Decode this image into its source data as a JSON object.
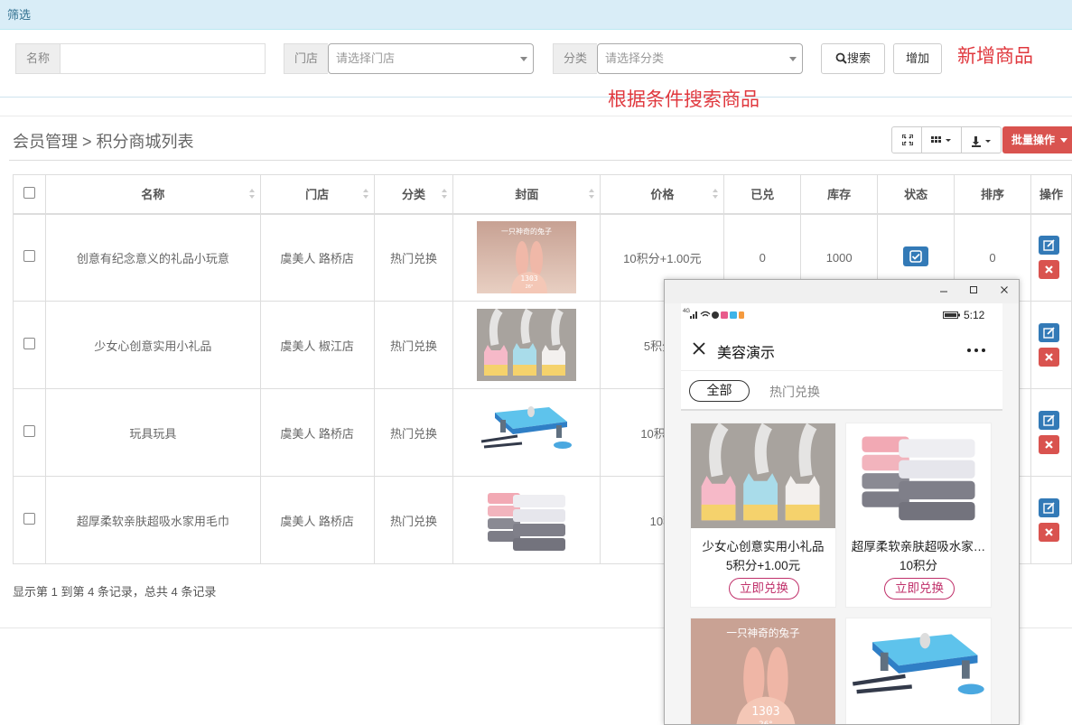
{
  "filter_bar": {
    "title": "筛选"
  },
  "filter_form": {
    "name_label": "名称",
    "name_value": "",
    "store_label": "门店",
    "store_placeholder": "请选择门店",
    "category_label": "分类",
    "category_placeholder": "请选择分类",
    "search_label": "搜索",
    "add_label": "增加"
  },
  "annotations": {
    "add_note": "新增商品",
    "search_note": "根据条件搜索商品"
  },
  "breadcrumb": "会员管理 > 积分商城列表",
  "toolbar": {
    "batch_label": "批量操作"
  },
  "table": {
    "columns": [
      "名称",
      "门店",
      "分类",
      "封面",
      "价格",
      "已兑",
      "库存",
      "状态",
      "排序",
      "操作"
    ],
    "rows": [
      {
        "name": "创意有纪念意义的礼品小玩意",
        "store": "虞美人 路桥店",
        "category": "热门兑换",
        "cover": "rabbit-clock",
        "price": "10积分+1.00元",
        "redeemed": "0",
        "stock": "1000",
        "sort": "0"
      },
      {
        "name": "少女心创意实用小礼品",
        "store": "虞美人 椒江店",
        "category": "热门兑换",
        "cover": "cat-humidifier",
        "price": "5积分+",
        "redeemed": "",
        "stock": "",
        "sort": ""
      },
      {
        "name": "玩具玩具",
        "store": "虞美人 路桥店",
        "category": "热门兑换",
        "cover": "penguin-ice-game",
        "price": "10积分+",
        "redeemed": "",
        "stock": "",
        "sort": ""
      },
      {
        "name": "超厚柔软亲肤超吸水家用毛巾",
        "store": "虞美人 路桥店",
        "category": "热门兑换",
        "cover": "towels",
        "price": "10积",
        "redeemed": "",
        "stock": "",
        "sort": ""
      }
    ]
  },
  "pager": "显示第 1 到第 4 条记录，总共 4 条记录",
  "phone": {
    "signal_text": "4G",
    "time": "5:12",
    "title": "美容演示",
    "tabs": [
      "全部",
      "热门兑换"
    ],
    "products": [
      {
        "name": "少女心创意实用小礼品",
        "price": "5积分+1.00元",
        "button": "立即兑换",
        "image": "cat-humidifier"
      },
      {
        "name": "超厚柔软亲肤超吸水家…",
        "price": "10积分",
        "button": "立即兑换",
        "image": "towels"
      },
      {
        "name": "",
        "price": "",
        "button": "",
        "image": "rabbit-clock",
        "image_text": "一只神奇的兔子"
      },
      {
        "name": "",
        "price": "",
        "button": "",
        "image": "penguin-ice-game"
      }
    ],
    "rabbit_image_text": "一只神奇的兔子",
    "rabbit_clock_time": "1303",
    "rabbit_clock_temp": "26°"
  },
  "colors": {
    "primary": "#337ab7",
    "danger": "#d9534f",
    "annotation": "#e0383e",
    "redeem": "#c0306a"
  }
}
